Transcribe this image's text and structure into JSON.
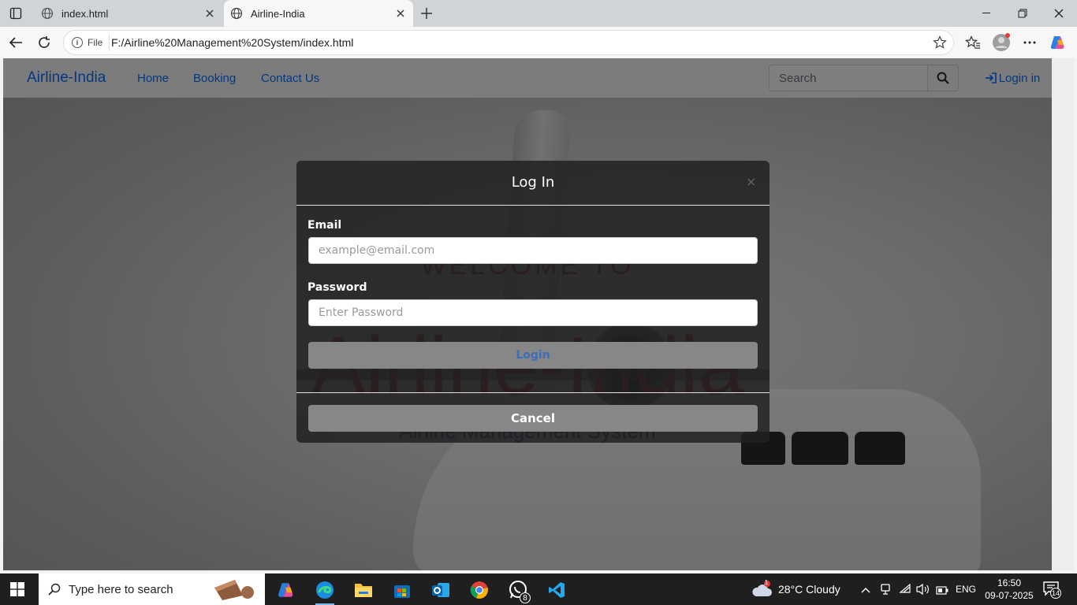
{
  "browser": {
    "tabs": [
      {
        "title": "index.html"
      },
      {
        "title": "Airline-India"
      }
    ],
    "address_chip": "File",
    "url": "F:/Airline%20Management%20System/index.html"
  },
  "navbar": {
    "brand": "Airline-India",
    "links": [
      "Home",
      "Booking",
      "Contact Us"
    ],
    "search_placeholder": "Search",
    "login_label": "Login in"
  },
  "hero": {
    "welcome": "WELCOME TO",
    "title": "Airline-India",
    "subtitle": "Airline Management System"
  },
  "modal": {
    "title": "Log In",
    "close": "×",
    "email_label": "Email",
    "email_placeholder": "example@email.com",
    "password_label": "Password",
    "password_placeholder": "Enter Password",
    "login_button": "Login",
    "cancel_button": "Cancel"
  },
  "taskbar": {
    "search_placeholder": "Type here to search",
    "weather": "28°C  Cloudy",
    "weather_badge": "1",
    "whatsapp_badge": "8",
    "language": "ENG",
    "time": "16:50",
    "date": "09-07-2025",
    "notifications": "14"
  },
  "colors": {
    "link": "#0d6efd",
    "hero_title": "#c0281e",
    "hero_subtitle": "#1c2f9b",
    "modal_bg": "#212121"
  }
}
